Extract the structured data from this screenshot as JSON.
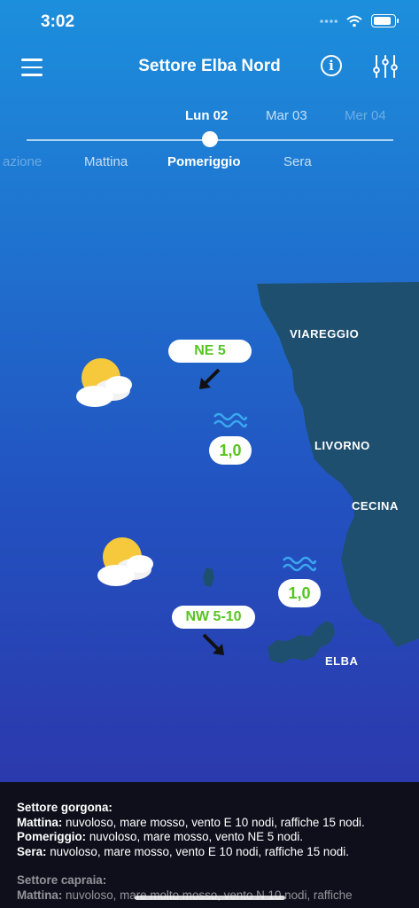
{
  "status": {
    "time": "3:02",
    "icons": [
      "signal-dots-icon",
      "wifi-icon",
      "battery-icon"
    ]
  },
  "header": {
    "title": "Settore Elba Nord",
    "icons": [
      "menu-icon",
      "info-icon",
      "filter-sliders-icon"
    ]
  },
  "days": [
    {
      "label": "Lun 02",
      "state": "active"
    },
    {
      "label": "Mar 03",
      "state": "inactive"
    },
    {
      "label": "Mer 04",
      "state": "faded"
    }
  ],
  "periods": [
    {
      "label": "azione",
      "state": "faded"
    },
    {
      "label": "Mattina",
      "state": "inactive"
    },
    {
      "label": "Pomeriggio",
      "state": "active"
    },
    {
      "label": "Sera",
      "state": "inactive"
    }
  ],
  "map": {
    "cities": [
      "VIAREGGIO",
      "LIVORNO",
      "CECINA",
      "ELBA"
    ],
    "zones": [
      {
        "weather_icon": "partly-cloudy-icon",
        "wind": "NE 5",
        "wave": "1,0"
      },
      {
        "weather_icon": "partly-cloudy-icon",
        "wind": "NW 5-10",
        "wave": "1,0"
      }
    ]
  },
  "bulletin": {
    "sector1": {
      "title": "Settore gorgona:",
      "lines": [
        {
          "label": "Mattina:",
          "text": " nuvoloso, mare mosso, vento E 10 nodi, raffiche 15 nodi."
        },
        {
          "label": "Pomeriggio:",
          "text": " nuvoloso, mare mosso, vento NE 5 nodi."
        },
        {
          "label": "Sera:",
          "text": " nuvoloso, mare mosso, vento E 10 nodi, raffiche 15 nodi."
        }
      ]
    },
    "sector2": {
      "title": "Settore capraia:",
      "lines": [
        {
          "label": "Mattina:",
          "text": " nuvoloso, mare molto mosso, vento N 10 nodi, raffiche"
        }
      ]
    }
  },
  "colors": {
    "accent_green": "#56c41f",
    "land": "#1e4f6e",
    "wave_blue": "#3aa8f0",
    "panel_bg": "#0f0f1c"
  }
}
